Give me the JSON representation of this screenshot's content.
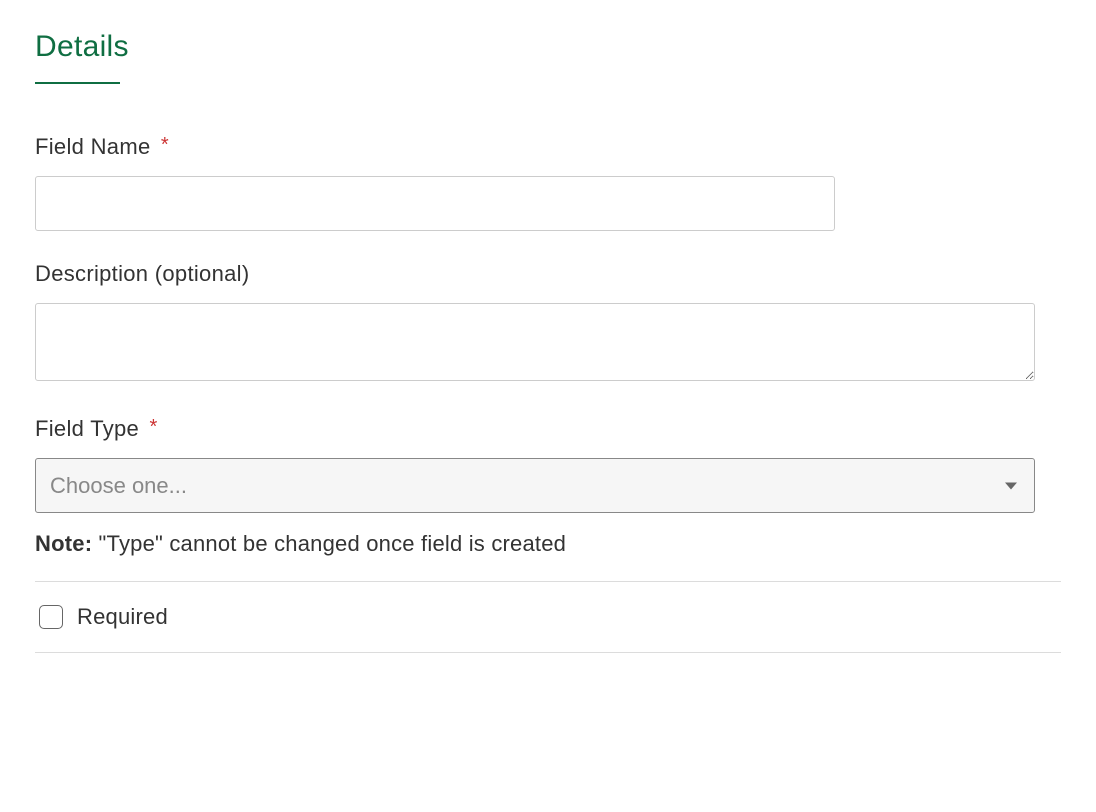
{
  "section": {
    "title": "Details"
  },
  "fields": {
    "fieldName": {
      "label": "Field Name",
      "required": true,
      "value": ""
    },
    "description": {
      "label": "Description (optional)",
      "required": false,
      "value": ""
    },
    "fieldType": {
      "label": "Field Type",
      "required": true,
      "placeholder": "Choose one...",
      "value": ""
    }
  },
  "note": {
    "label": "Note:",
    "text": "\"Type\" cannot be changed once field is created"
  },
  "requiredCheckbox": {
    "label": "Required",
    "checked": false
  },
  "colors": {
    "accent": "#0f6e42",
    "asterisk": "#cc3333"
  }
}
